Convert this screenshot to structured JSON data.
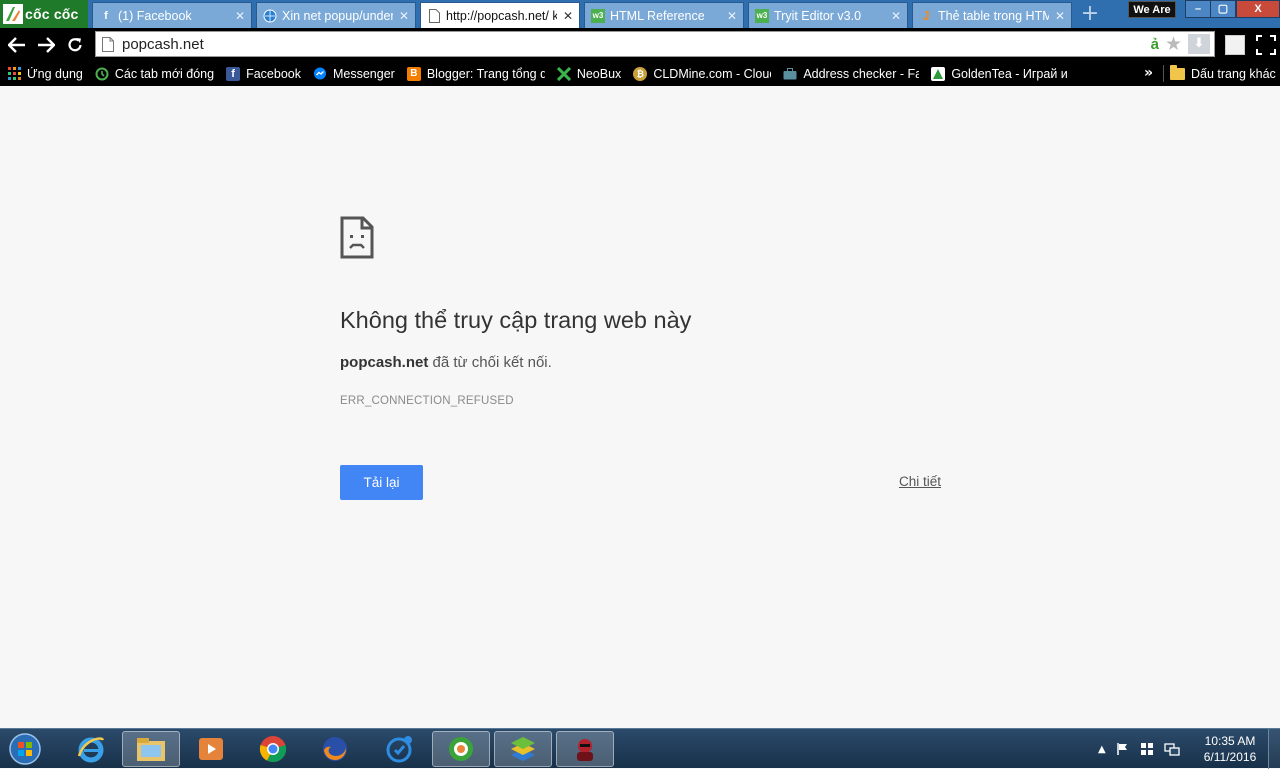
{
  "browser": {
    "brand": "cốc cốc",
    "tabs": [
      {
        "title": "(1) Facebook",
        "icon": "facebook-icon",
        "active": false
      },
      {
        "title": "Xin net popup/under",
        "icon": "globe-icon",
        "active": false
      },
      {
        "title": "http://popcash.net/ k",
        "icon": "page-icon",
        "active": true
      },
      {
        "title": "HTML Reference",
        "icon": "w3schools-icon",
        "active": false
      },
      {
        "title": "Tryit Editor v3.0",
        "icon": "w3schools-icon",
        "active": false
      },
      {
        "title": "Thẻ table trong HTM",
        "icon": "j-icon",
        "active": false
      }
    ],
    "extension_badge": "We Are",
    "window_controls": {
      "minimize": "–",
      "maximize": "▢",
      "close": "X"
    }
  },
  "toolbar": {
    "url": "popcash.net",
    "omnibox_letter": "ả"
  },
  "bookmarks": {
    "items": [
      {
        "label": "Ứng dụng",
        "icon": "apps-grid-icon"
      },
      {
        "label": "Các tab mới đóng",
        "icon": "history-icon"
      },
      {
        "label": "Facebook",
        "icon": "facebook-icon"
      },
      {
        "label": "Messenger",
        "icon": "messenger-icon"
      },
      {
        "label": "Blogger: Trang tổng q",
        "icon": "blogger-icon"
      },
      {
        "label": "NeoBux",
        "icon": "neobux-icon"
      },
      {
        "label": "CLDMine.com - Cloud",
        "icon": "bitcoin-icon"
      },
      {
        "label": "Address checker - Fau",
        "icon": "briefcase-icon"
      },
      {
        "label": "GoldenTea - Играй и",
        "icon": "goldentea-icon"
      }
    ],
    "more": "»",
    "other_folder": "Dấu trang khác"
  },
  "error_page": {
    "heading": "Không thể truy cập trang web này",
    "host": "popcash.net",
    "summary_rest": " đã từ chối kết nối.",
    "error_code": "ERR_CONNECTION_REFUSED",
    "reload_label": "Tải lại",
    "details_label": "Chi tiết",
    "reload_color": "#4285f4"
  },
  "taskbar": {
    "apps": [
      "ie-icon",
      "file-explorer-icon",
      "media-player-icon",
      "chrome-icon",
      "firefox-icon",
      "coccoc-update-icon",
      "coccoc-icon",
      "bluestacks-icon",
      "spy-game-icon"
    ],
    "time": "10:35 AM",
    "date": "6/11/2016"
  }
}
